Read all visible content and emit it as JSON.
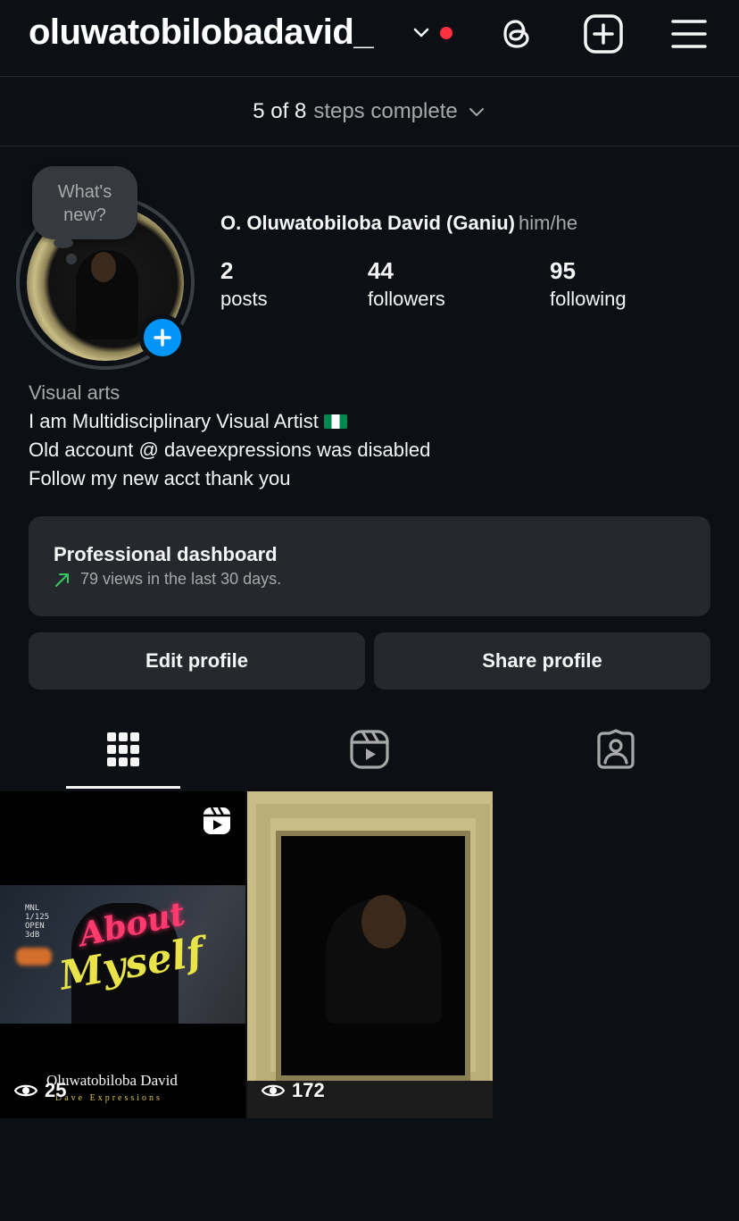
{
  "header": {
    "username": "oluwatobilobadavid_"
  },
  "steps": {
    "count": "5 of 8",
    "label": "steps complete"
  },
  "avatar_bubble": {
    "line1": "What's",
    "line2": "new?"
  },
  "profile": {
    "full_name": "O. Oluwatobiloba David (Ganiu)",
    "pronouns": "him/he",
    "stats": [
      {
        "value": "2",
        "label": "posts"
      },
      {
        "value": "44",
        "label": "followers"
      },
      {
        "value": "95",
        "label": "following"
      }
    ]
  },
  "bio": {
    "category": "Visual arts",
    "line1": "I am Multidisciplinary Visual Artist",
    "line2": "Old account @ daveexpressions was disabled",
    "line3": "Follow my new acct thank you"
  },
  "dashboard": {
    "title": "Professional dashboard",
    "subtitle": "79 views in the last 30 days."
  },
  "actions": {
    "edit": "Edit profile",
    "share": "Share profile"
  },
  "tabs": [
    "posts-grid",
    "reels",
    "tagged"
  ],
  "posts": [
    {
      "views": "25",
      "type": "reel",
      "overlay_about": "About",
      "overlay_myself": "Myself",
      "caption": "Oluwatobiloba David",
      "caption_sub": "Dave Expressions",
      "camera_text": [
        "MNL",
        "1/125",
        "OPEN",
        "3dB"
      ]
    },
    {
      "views": "172",
      "type": "photo"
    }
  ],
  "colors": {
    "background": "#0c1014",
    "card": "#25292e",
    "accent_blue": "#0095f6",
    "notif_red": "#ff3040",
    "trend_green": "#36c95f"
  }
}
